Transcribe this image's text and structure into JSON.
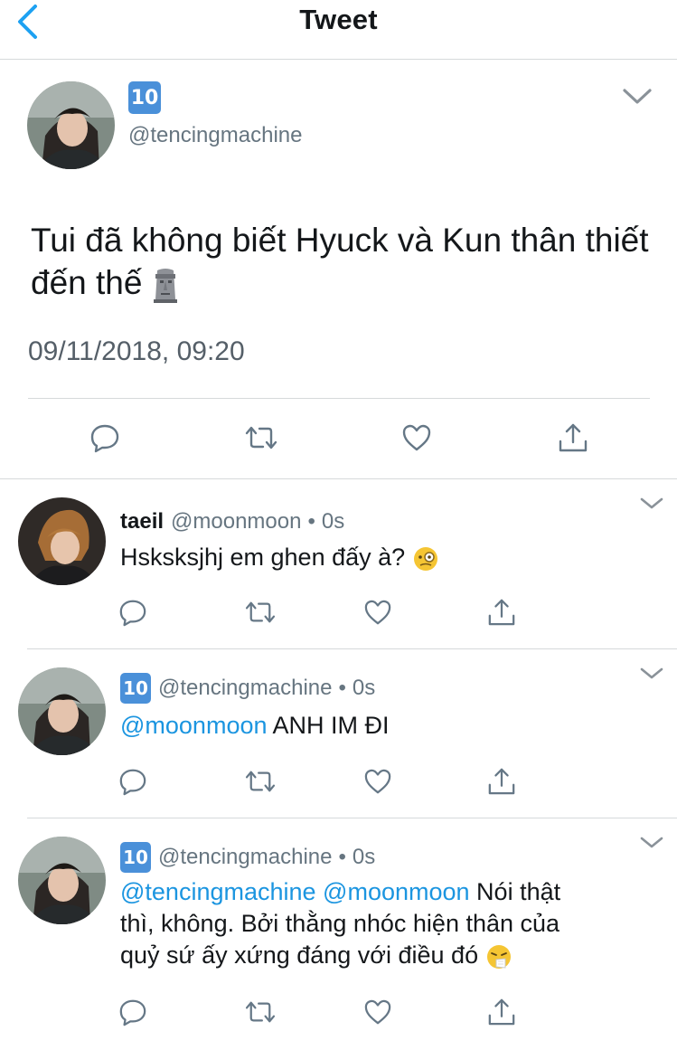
{
  "nav": {
    "title": "Tweet"
  },
  "main_tweet": {
    "name_badge": "10",
    "handle": "@tencingmachine",
    "text": "Tui đã không biết Hyuck và Kun thân thiết đến thế",
    "emoji": "moai-emoji",
    "timestamp": "09/11/2018, 09:20"
  },
  "replies": [
    {
      "name": "taeil",
      "handle": "@moonmoon",
      "dot": "•",
      "time": "0s",
      "text": "Hsksksjhj em ghen đấy à?",
      "emoji": "monocle-face-emoji"
    },
    {
      "name_badge": "10",
      "handle": "@tencingmachine",
      "dot": "•",
      "time": "0s",
      "mention": "@moonmoon",
      "text": " ANH IM ĐI"
    },
    {
      "name_badge": "10",
      "handle": "@tencingmachine",
      "dot": "•",
      "time": "0s",
      "mention1": "@tencingmachine",
      "mention2": "@moonmoon",
      "text": " Nói thật thì, không. Bởi thằng nhóc hiện thân của quỷ sứ ấy xứng đáng với điều đó",
      "emoji": "sneezing-face-emoji"
    }
  ],
  "colors": {
    "link": "#1b95e0",
    "icon": "#657786",
    "back": "#1da1f2",
    "divider": "#d6d9db",
    "badge": "#4a90d9"
  }
}
